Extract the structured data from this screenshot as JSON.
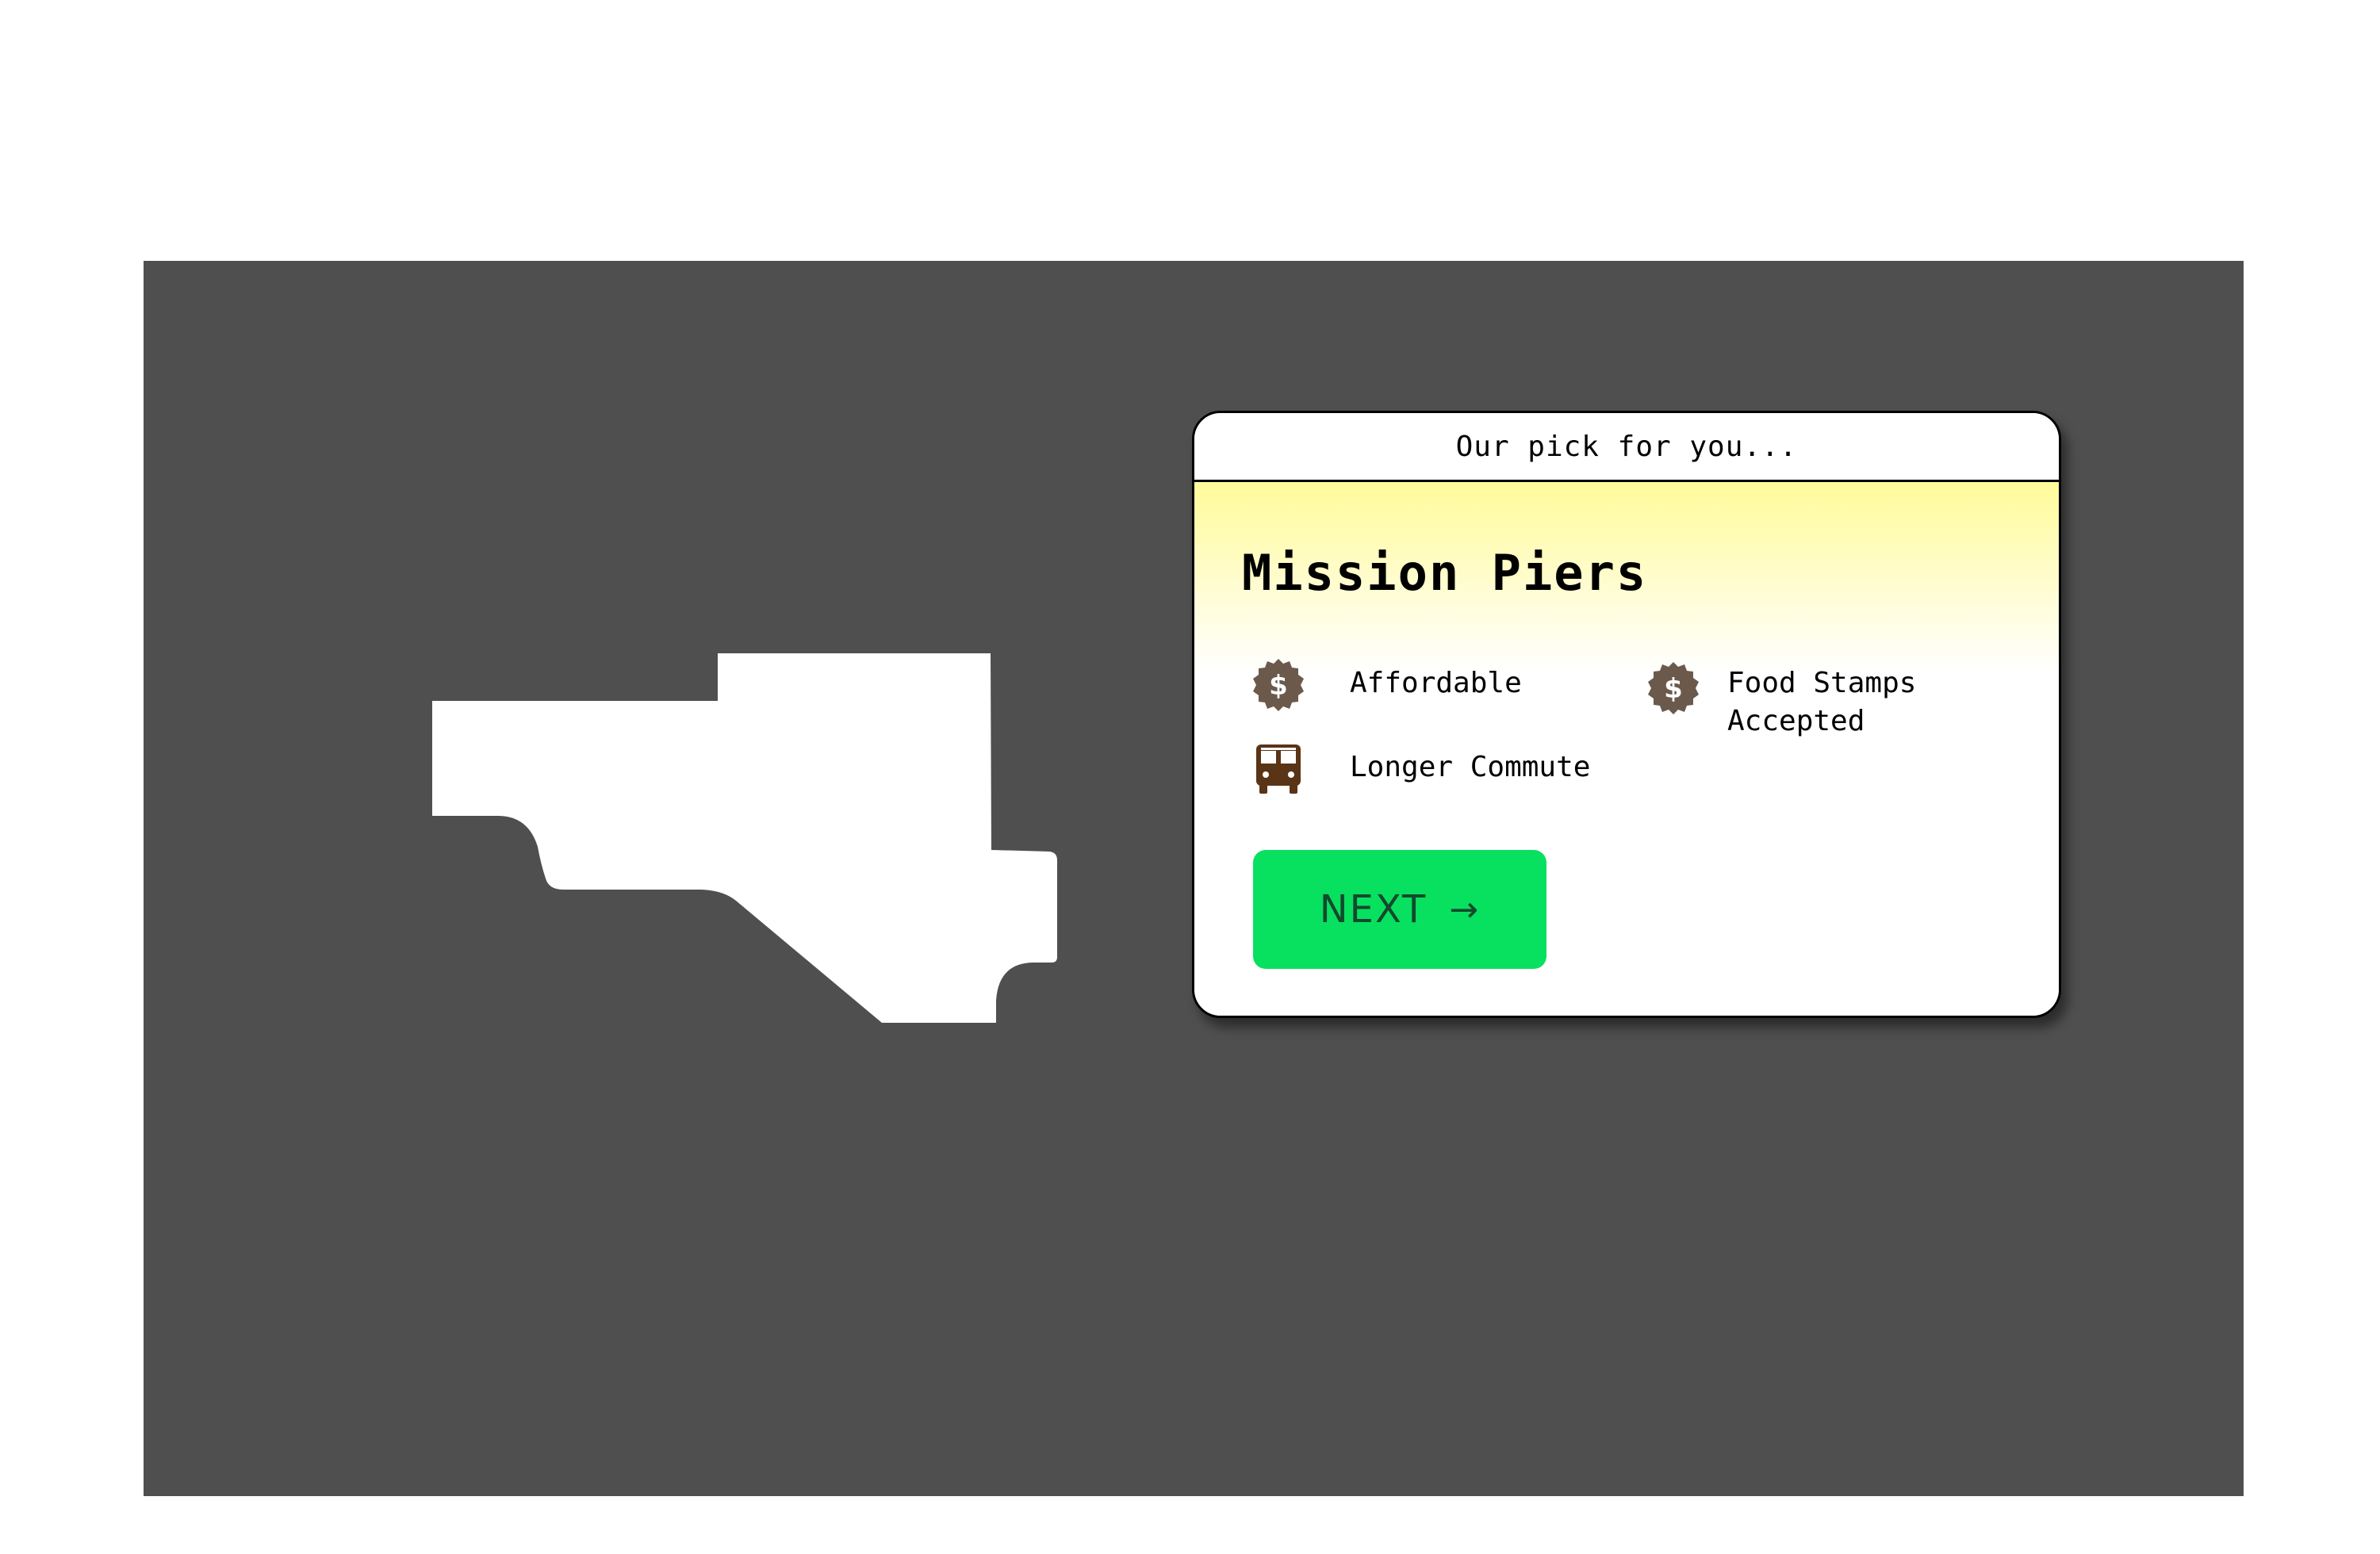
{
  "card": {
    "header": "Our pick for you...",
    "title": "Mission Piers",
    "features": [
      {
        "icon": "dollar-badge-icon",
        "label": "Affordable"
      },
      {
        "icon": "dollar-badge-icon",
        "label": "Food Stamps\nAccepted"
      },
      {
        "icon": "bus-icon",
        "label": "Longer Commute"
      }
    ],
    "next_label": "NEXT",
    "next_arrow": "→"
  },
  "colors": {
    "stage_background": "#4f4f4f",
    "card_gradient_top": "#fffb9a",
    "button_green": "#08e060",
    "icon_brown": "#6b5a4c",
    "bus_brown": "#5a3416"
  }
}
